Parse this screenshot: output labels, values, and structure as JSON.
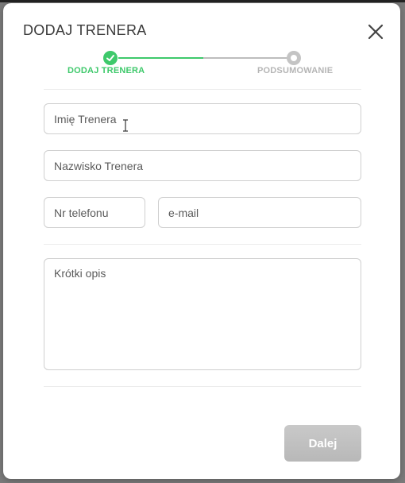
{
  "modal": {
    "title": "DODAJ TRENERA"
  },
  "stepper": {
    "steps": [
      {
        "label": "DODAJ TRENERA",
        "state": "done"
      },
      {
        "label": "PODSUMOWANIE",
        "state": "todo"
      }
    ],
    "colors": {
      "done": "#3ec96b",
      "todo": "#bdbdbd"
    }
  },
  "form": {
    "first_name": {
      "value": "",
      "placeholder": "Imię Trenera"
    },
    "last_name": {
      "value": "",
      "placeholder": "Nazwisko Trenera"
    },
    "phone": {
      "value": "",
      "placeholder": "Nr telefonu"
    },
    "email": {
      "value": "",
      "placeholder": "e-mail"
    },
    "description": {
      "value": "",
      "placeholder": "Krótki opis"
    }
  },
  "actions": {
    "next_label": "Dalej"
  },
  "icons": {
    "close": "close-icon",
    "check": "check-icon",
    "cursor": "text-cursor-icon"
  }
}
